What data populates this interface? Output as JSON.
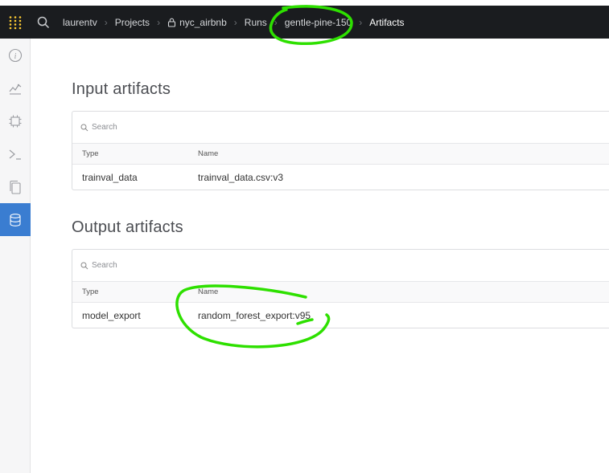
{
  "topbar": {
    "logo_icon": "wandb-logo-icon",
    "search_icon": "search-icon",
    "breadcrumb": {
      "user": "laurentv",
      "projects": "Projects",
      "project": "nyc_airbnb",
      "runs": "Runs",
      "run": "gentle-pine-150",
      "page": "Artifacts"
    }
  },
  "sidebar": {
    "items": [
      {
        "icon": "info-icon",
        "active": false
      },
      {
        "icon": "chart-icon",
        "active": false
      },
      {
        "icon": "cpu-icon",
        "active": false
      },
      {
        "icon": "terminal-icon",
        "active": false
      },
      {
        "icon": "files-icon",
        "active": false
      },
      {
        "icon": "database-icon",
        "active": true
      }
    ]
  },
  "input_artifacts": {
    "title": "Input artifacts",
    "search_placeholder": "Search",
    "columns": {
      "type": "Type",
      "name": "Name"
    },
    "rows": [
      {
        "type": "trainval_data",
        "name": "trainval_data.csv:v3"
      }
    ]
  },
  "output_artifacts": {
    "title": "Output artifacts",
    "search_placeholder": "Search",
    "columns": {
      "type": "Type",
      "name": "Name"
    },
    "rows": [
      {
        "type": "model_export",
        "name": "random_forest_export:v95"
      }
    ]
  },
  "colors": {
    "topbar_bg": "#1a1c1f",
    "sidebar_active": "#3a7dd1",
    "logo_yellow": "#ffcc33",
    "annotation_green": "#2ee000"
  }
}
